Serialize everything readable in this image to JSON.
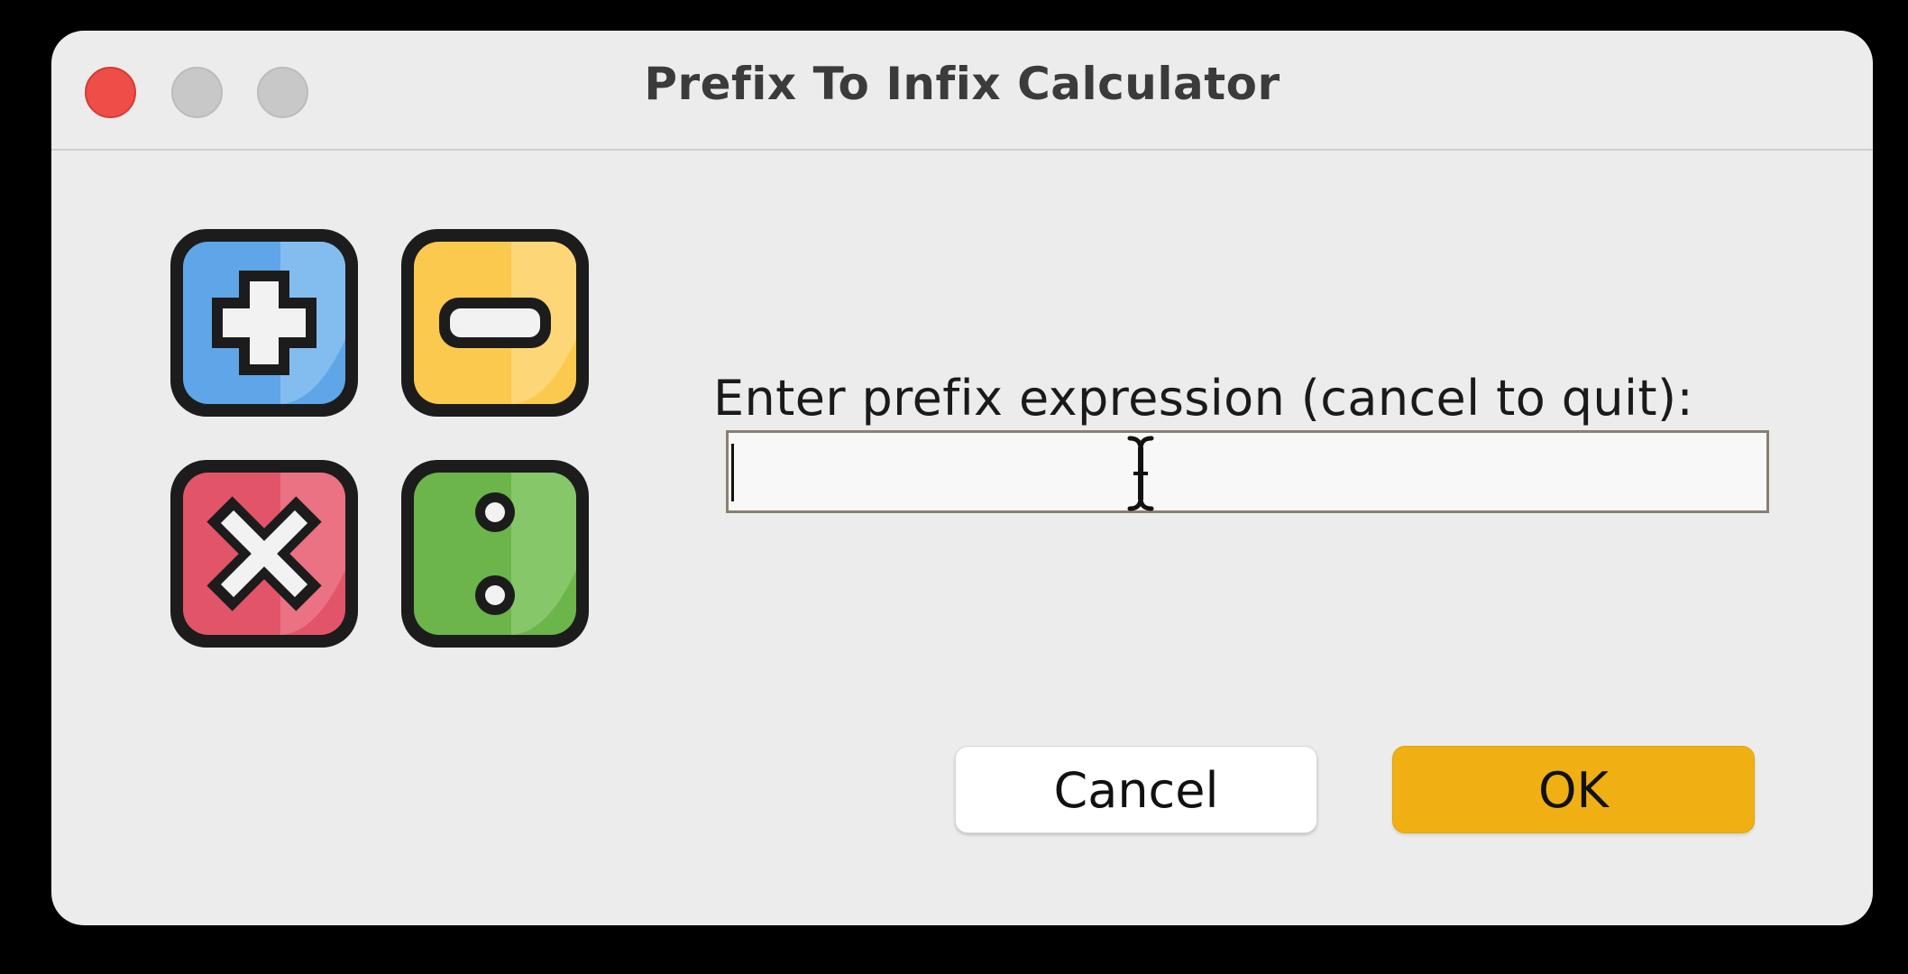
{
  "window": {
    "title": "Prefix To Infix Calculator"
  },
  "dialog": {
    "prompt": "Enter prefix expression (cancel to quit):",
    "input_value": "",
    "icon": "calculator-operators-icon"
  },
  "buttons": {
    "cancel_label": "Cancel",
    "ok_label": "OK"
  },
  "colors": {
    "close": "#ee4d48",
    "accent_ok": "#f0b013",
    "plus_tile": "#5fa6e8",
    "minus_tile": "#fbc94e",
    "times_tile": "#e25468",
    "divide_tile": "#6bb54b"
  }
}
